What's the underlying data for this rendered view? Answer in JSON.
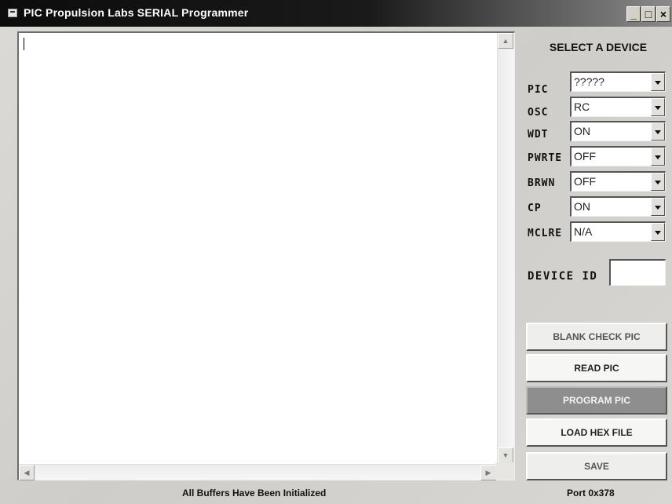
{
  "window": {
    "title": "PIC Propulsion Labs SERIAL Programmer",
    "controls": {
      "minimize": "_",
      "maximize": "□",
      "close": "×"
    }
  },
  "panel": {
    "heading": "SELECT A DEVICE",
    "fields": [
      {
        "label": "PIC",
        "value": "?????"
      },
      {
        "label": "OSC",
        "value": "RC"
      },
      {
        "label": "WDT",
        "value": "ON"
      },
      {
        "label": "PWRTE",
        "value": "OFF"
      },
      {
        "label": "BRWN",
        "value": "OFF"
      },
      {
        "label": "CP",
        "value": "ON"
      },
      {
        "label": "MCLRE",
        "value": "N/A"
      }
    ],
    "device_id_label": "DEVICE ID",
    "device_id_value": ""
  },
  "buttons": {
    "blank_check": "BLANK CHECK PIC",
    "read": "READ PIC",
    "program": "PROGRAM PIC",
    "load_hex": "LOAD HEX FILE",
    "save": "SAVE"
  },
  "status": {
    "message": "All Buffers Have Been Initialized",
    "port": "Port 0x378"
  }
}
